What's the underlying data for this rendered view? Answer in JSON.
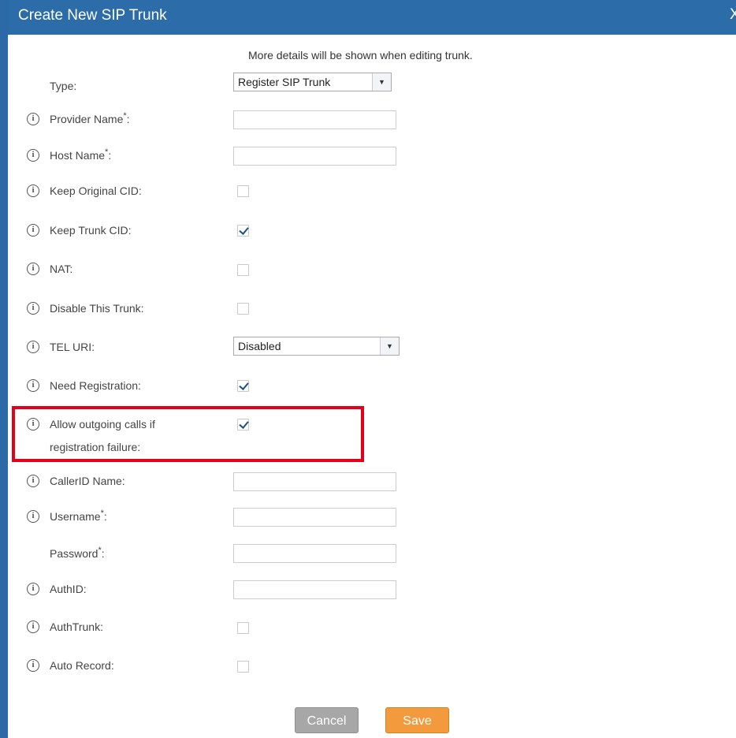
{
  "dialog": {
    "title": "Create New SIP Trunk",
    "close_glyph": "X",
    "hint": "More details will be shown when editing trunk."
  },
  "fields": {
    "type": {
      "label": "Type:",
      "value": "Register SIP Trunk"
    },
    "provider_name": {
      "label": "Provider Name",
      "required": "*",
      "colon": ":",
      "value": ""
    },
    "host_name": {
      "label": "Host Name",
      "required": "*",
      "colon": ":",
      "value": ""
    },
    "keep_original_cid": {
      "label": "Keep Original CID:",
      "checked": false
    },
    "keep_trunk_cid": {
      "label": "Keep Trunk CID:",
      "checked": true
    },
    "nat": {
      "label": "NAT:",
      "checked": false
    },
    "disable_trunk": {
      "label": "Disable This Trunk:",
      "checked": false
    },
    "tel_uri": {
      "label": "TEL URI:",
      "value": "Disabled"
    },
    "need_registration": {
      "label": "Need Registration:",
      "checked": true
    },
    "allow_outgoing": {
      "label_line1": "Allow outgoing calls if",
      "label_line2": "registration failure:",
      "checked": true
    },
    "callerid_name": {
      "label": "CallerID Name:",
      "value": ""
    },
    "username": {
      "label": "Username",
      "required": "*",
      "colon": ":",
      "value": ""
    },
    "password": {
      "label": "Password",
      "required": "*",
      "colon": ":",
      "value": ""
    },
    "authid": {
      "label": "AuthID:",
      "value": ""
    },
    "authtrunk": {
      "label": "AuthTrunk:",
      "checked": false
    },
    "auto_record": {
      "label": "Auto Record:",
      "checked": false
    }
  },
  "buttons": {
    "cancel": "Cancel",
    "save": "Save"
  },
  "icons": {
    "info": "info-circle-icon",
    "dropdown": "chevron-down-icon"
  },
  "info_glyph": "i",
  "arrow_glyph": "▼",
  "colors": {
    "titlebar": "#2c6ca9",
    "highlight": "#e3001b",
    "save": "#f39a3d",
    "cancel": "#a7a7a7",
    "check": "#1e4f86"
  }
}
